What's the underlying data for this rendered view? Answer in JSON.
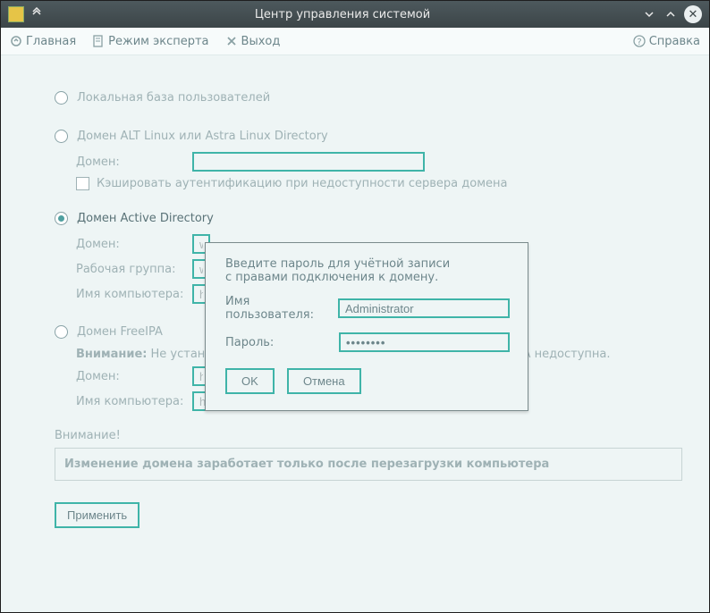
{
  "titlebar": {
    "title": "Центр управления системой"
  },
  "toolbar": {
    "home": "Главная",
    "expert": "Режим эксперта",
    "exit": "Выход",
    "help": "Справка"
  },
  "radios": {
    "local": "Локальная база пользователей",
    "alt": "Домен ALT Linux или Astra Linux Directory",
    "ad": "Домен Active Directory",
    "ipa": "Домен FreeIPA"
  },
  "labels": {
    "domain": "Домен:",
    "cache": "Кэшировать аутентификацию при недоступности сервера домена",
    "workgroup": "Рабочая группа:",
    "hostname": "Имя компьютера:",
    "warn": "Внимание:",
    "ipa_warn": "Не установлен пакет, поэтому аутентификация через FreeIPA недоступна.",
    "notice_title": "Внимание!",
    "notice_text": "Изменение домена заработает только после перезагрузки компьютера",
    "apply": "Применить"
  },
  "values": {
    "alt_domain": "",
    "ad_domain": "w",
    "ad_workgroup": "w",
    "ad_host": "h",
    "ipa_domain": "h",
    "ipa_host": "host-101"
  },
  "modal": {
    "line1": "Введите пароль для учётной записи",
    "line2": "с правами подключения к домену.",
    "user_label": "Имя пользователя:",
    "user_value": "Administrator",
    "pass_label": "Пароль:",
    "pass_value": "••••••••",
    "ok": "OK",
    "cancel": "Отмена"
  }
}
